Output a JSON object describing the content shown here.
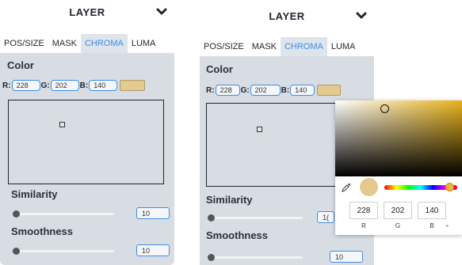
{
  "left_panel": {
    "header": "LAYER",
    "tabs": [
      "POS/SIZE",
      "MASK",
      "CHROMA",
      "LUMA"
    ],
    "active_tab": "CHROMA",
    "color_title": "Color",
    "r_label": "R:",
    "g_label": "G:",
    "b_label": "B:",
    "r_value": "228",
    "g_value": "202",
    "b_value": "140",
    "similarity_title": "Similarity",
    "similarity_value": "10",
    "smoothness_title": "Smoothness",
    "smoothness_value": "10"
  },
  "right_panel": {
    "header": "LAYER",
    "tabs": [
      "POS/SIZE",
      "MASK",
      "CHROMA",
      "LUMA"
    ],
    "active_tab": "CHROMA",
    "color_title": "Color",
    "r_label": "R:",
    "g_label": "G:",
    "b_label": "B:",
    "r_value": "228",
    "g_value": "202",
    "b_value": "140",
    "similarity_title": "Similarity",
    "similarity_value": "1(",
    "smoothness_title": "Smoothness",
    "smoothness_value": "10"
  },
  "color_picker": {
    "r": "228",
    "g": "202",
    "b": "140",
    "r_label": "R",
    "g_label": "G",
    "b_label": "B",
    "toggle_glyph": "÷"
  },
  "colors": {
    "accent": "#3d8fe6",
    "swatch": "#e4ca8c",
    "panel_bg": "#d8dde3"
  },
  "icons": [
    "chevron-down-icon",
    "eyedropper-icon"
  ]
}
